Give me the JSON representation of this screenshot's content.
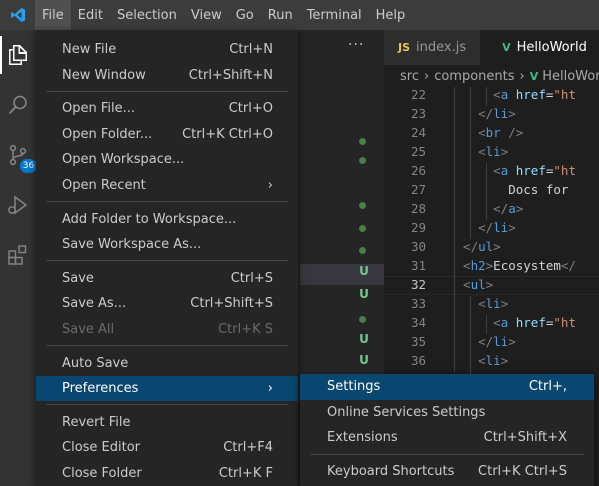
{
  "menubar": {
    "items": [
      "File",
      "Edit",
      "Selection",
      "View",
      "Go",
      "Run",
      "Terminal",
      "Help"
    ],
    "active_index": 0
  },
  "activity_bar": {
    "icons": [
      "files-icon",
      "search-icon",
      "source-control-icon",
      "run-debug-icon",
      "extensions-icon"
    ],
    "source_control_badge": "36"
  },
  "sidebar": {
    "more_actions": "···",
    "git_markers": [
      {
        "type": "dot"
      },
      {
        "type": "dot"
      },
      {
        "type": "dot"
      },
      {
        "type": "dot"
      },
      {
        "type": "dot"
      },
      {
        "type": "U"
      },
      {
        "type": "U"
      },
      {
        "type": "dot"
      },
      {
        "type": "U"
      },
      {
        "type": "U"
      }
    ]
  },
  "editor": {
    "tabs": [
      {
        "label": "index.js",
        "icon": "JS",
        "active": false
      },
      {
        "label": "HelloWorld",
        "icon": "V",
        "active": true
      }
    ],
    "breadcrumb": [
      "src",
      "components",
      "HelloWorld"
    ],
    "current_line": 32,
    "lines": [
      {
        "n": "22",
        "parts": [
          {
            "c": "tag",
            "t": "      <"
          },
          {
            "c": "tname",
            "t": "a"
          },
          {
            "c": "attr",
            "t": " href"
          },
          {
            "c": "txt",
            "t": "="
          },
          {
            "c": "str",
            "t": "\"ht"
          }
        ]
      },
      {
        "n": "23",
        "parts": [
          {
            "c": "tag",
            "t": "    </"
          },
          {
            "c": "tname",
            "t": "li"
          },
          {
            "c": "tag",
            "t": ">"
          }
        ]
      },
      {
        "n": "24",
        "parts": [
          {
            "c": "tag",
            "t": "    <"
          },
          {
            "c": "tname",
            "t": "br"
          },
          {
            "c": "tag",
            "t": " />"
          }
        ]
      },
      {
        "n": "25",
        "parts": [
          {
            "c": "tag",
            "t": "    <"
          },
          {
            "c": "tname",
            "t": "li"
          },
          {
            "c": "tag",
            "t": ">"
          }
        ]
      },
      {
        "n": "26",
        "parts": [
          {
            "c": "tag",
            "t": "      <"
          },
          {
            "c": "tname",
            "t": "a"
          },
          {
            "c": "attr",
            "t": " href"
          },
          {
            "c": "txt",
            "t": "="
          },
          {
            "c": "str",
            "t": "\"ht"
          }
        ]
      },
      {
        "n": "27",
        "parts": [
          {
            "c": "txt",
            "t": "        Docs for"
          }
        ]
      },
      {
        "n": "28",
        "parts": [
          {
            "c": "tag",
            "t": "      </"
          },
          {
            "c": "tname",
            "t": "a"
          },
          {
            "c": "tag",
            "t": ">"
          }
        ]
      },
      {
        "n": "29",
        "parts": [
          {
            "c": "tag",
            "t": "    </"
          },
          {
            "c": "tname",
            "t": "li"
          },
          {
            "c": "tag",
            "t": ">"
          }
        ]
      },
      {
        "n": "30",
        "parts": [
          {
            "c": "tag",
            "t": "  </"
          },
          {
            "c": "tname",
            "t": "ul"
          },
          {
            "c": "tag",
            "t": ">"
          }
        ]
      },
      {
        "n": "31",
        "parts": [
          {
            "c": "tag",
            "t": "  <"
          },
          {
            "c": "tname",
            "t": "h2"
          },
          {
            "c": "tag",
            "t": ">"
          },
          {
            "c": "txt",
            "t": "Ecosystem"
          },
          {
            "c": "tag",
            "t": "</"
          }
        ]
      },
      {
        "n": "32",
        "parts": [
          {
            "c": "tag",
            "t": "  <"
          },
          {
            "c": "tname",
            "t": "ul"
          },
          {
            "c": "tag",
            "t": ">"
          }
        ]
      },
      {
        "n": "33",
        "parts": [
          {
            "c": "tag",
            "t": "    <"
          },
          {
            "c": "tname",
            "t": "li"
          },
          {
            "c": "tag",
            "t": ">"
          }
        ]
      },
      {
        "n": "34",
        "parts": [
          {
            "c": "tag",
            "t": "      <"
          },
          {
            "c": "tname",
            "t": "a"
          },
          {
            "c": "attr",
            "t": " href"
          },
          {
            "c": "txt",
            "t": "="
          },
          {
            "c": "str",
            "t": "\"ht"
          }
        ]
      },
      {
        "n": "35",
        "parts": [
          {
            "c": "tag",
            "t": "    </"
          },
          {
            "c": "tname",
            "t": "li"
          },
          {
            "c": "tag",
            "t": ">"
          }
        ]
      },
      {
        "n": "36",
        "parts": [
          {
            "c": "tag",
            "t": "    <"
          },
          {
            "c": "tname",
            "t": "li"
          },
          {
            "c": "tag",
            "t": ">"
          }
        ]
      }
    ]
  },
  "file_menu": {
    "groups": [
      [
        {
          "label": "New File",
          "shortcut": "Ctrl+N"
        },
        {
          "label": "New Window",
          "shortcut": "Ctrl+Shift+N"
        }
      ],
      [
        {
          "label": "Open File...",
          "shortcut": "Ctrl+O"
        },
        {
          "label": "Open Folder...",
          "shortcut": "Ctrl+K Ctrl+O"
        },
        {
          "label": "Open Workspace...",
          "shortcut": ""
        },
        {
          "label": "Open Recent",
          "shortcut": "",
          "submenu": true
        }
      ],
      [
        {
          "label": "Add Folder to Workspace...",
          "shortcut": ""
        },
        {
          "label": "Save Workspace As...",
          "shortcut": ""
        }
      ],
      [
        {
          "label": "Save",
          "shortcut": "Ctrl+S"
        },
        {
          "label": "Save As...",
          "shortcut": "Ctrl+Shift+S"
        },
        {
          "label": "Save All",
          "shortcut": "Ctrl+K S",
          "disabled": true
        }
      ],
      [
        {
          "label": "Auto Save",
          "shortcut": ""
        },
        {
          "label": "Preferences",
          "shortcut": "",
          "submenu": true,
          "highlight": true
        }
      ],
      [
        {
          "label": "Revert File",
          "shortcut": ""
        },
        {
          "label": "Close Editor",
          "shortcut": "Ctrl+F4"
        },
        {
          "label": "Close Folder",
          "shortcut": "Ctrl+K F"
        }
      ]
    ]
  },
  "preferences_menu": {
    "groups": [
      [
        {
          "label": "Settings",
          "shortcut": "Ctrl+,",
          "highlight": true
        },
        {
          "label": "Online Services Settings",
          "shortcut": ""
        },
        {
          "label": "Extensions",
          "shortcut": "Ctrl+Shift+X"
        }
      ],
      [
        {
          "label": "Keyboard Shortcuts",
          "shortcut": "Ctrl+K Ctrl+S"
        }
      ]
    ]
  },
  "colors": {
    "accent": "#007acc",
    "highlight": "#094771",
    "menubar": "#3c3c3c",
    "activity_bar": "#333333",
    "menu_bg": "#252526"
  }
}
